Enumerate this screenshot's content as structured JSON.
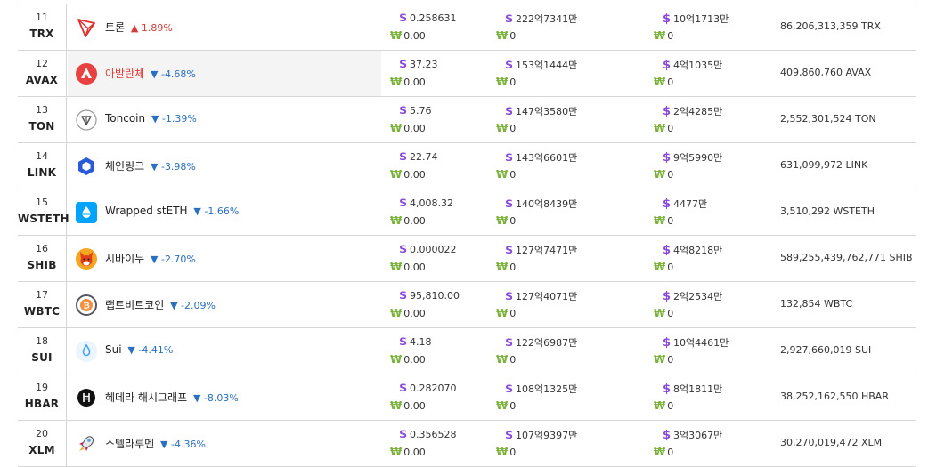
{
  "rows": [
    {
      "rank": "11",
      "symbol": "TRX",
      "name": "트론",
      "name_red": false,
      "arrow": "▲",
      "dir": "up",
      "change": "1.89%",
      "price_usd": "0.258631",
      "price_krw": "0.00",
      "cap_usd": "222억7341만",
      "cap_krw": "0",
      "vol_usd": "10억1713만",
      "vol_krw": "0",
      "supply": "86,206,313,359 TRX",
      "icon": "tron-icon",
      "highlight": false
    },
    {
      "rank": "12",
      "symbol": "AVAX",
      "name": "아발란체",
      "name_red": true,
      "arrow": "▼",
      "dir": "down",
      "change": "-4.68%",
      "price_usd": "37.23",
      "price_krw": "0.00",
      "cap_usd": "153억1444만",
      "cap_krw": "0",
      "vol_usd": "4억1035만",
      "vol_krw": "0",
      "supply": "409,860,760 AVAX",
      "icon": "avalanche-icon",
      "highlight": true
    },
    {
      "rank": "13",
      "symbol": "TON",
      "name": "Toncoin",
      "name_red": false,
      "arrow": "▼",
      "dir": "down",
      "change": "-1.39%",
      "price_usd": "5.76",
      "price_krw": "0.00",
      "cap_usd": "147억3580만",
      "cap_krw": "0",
      "vol_usd": "2억4285만",
      "vol_krw": "0",
      "supply": "2,552,301,524 TON",
      "icon": "toncoin-icon",
      "highlight": false
    },
    {
      "rank": "14",
      "symbol": "LINK",
      "name": "체인링크",
      "name_red": false,
      "arrow": "▼",
      "dir": "down",
      "change": "-3.98%",
      "price_usd": "22.74",
      "price_krw": "0.00",
      "cap_usd": "143억6601만",
      "cap_krw": "0",
      "vol_usd": "9억5990만",
      "vol_krw": "0",
      "supply": "631,099,972 LINK",
      "icon": "chainlink-icon",
      "highlight": false
    },
    {
      "rank": "15",
      "symbol": "WSTETH",
      "name": "Wrapped stETH",
      "name_red": false,
      "arrow": "▼",
      "dir": "down",
      "change": "-1.66%",
      "price_usd": "4,008.32",
      "price_krw": "0.00",
      "cap_usd": "140억8439만",
      "cap_krw": "0",
      "vol_usd": "4477만",
      "vol_krw": "0",
      "supply": "3,510,292 WSTETH",
      "icon": "wsteth-icon",
      "highlight": false
    },
    {
      "rank": "16",
      "symbol": "SHIB",
      "name": "시바이누",
      "name_red": false,
      "arrow": "▼",
      "dir": "down",
      "change": "-2.70%",
      "price_usd": "0.000022",
      "price_krw": "0.00",
      "cap_usd": "127억7471만",
      "cap_krw": "0",
      "vol_usd": "4억8218만",
      "vol_krw": "0",
      "supply": "589,255,439,762,771 SHIB",
      "icon": "shiba-inu-icon",
      "highlight": false
    },
    {
      "rank": "17",
      "symbol": "WBTC",
      "name": "랩트비트코인",
      "name_red": false,
      "arrow": "▼",
      "dir": "down",
      "change": "-2.09%",
      "price_usd": "95,810.00",
      "price_krw": "0.00",
      "cap_usd": "127억4071만",
      "cap_krw": "0",
      "vol_usd": "2억2534만",
      "vol_krw": "0",
      "supply": "132,854 WBTC",
      "icon": "wbtc-icon",
      "highlight": false
    },
    {
      "rank": "18",
      "symbol": "SUI",
      "name": "Sui",
      "name_red": false,
      "arrow": "▼",
      "dir": "down",
      "change": "-4.41%",
      "price_usd": "4.18",
      "price_krw": "0.00",
      "cap_usd": "122억6987만",
      "cap_krw": "0",
      "vol_usd": "10억4461만",
      "vol_krw": "0",
      "supply": "2,927,660,019 SUI",
      "icon": "sui-icon",
      "highlight": false
    },
    {
      "rank": "19",
      "symbol": "HBAR",
      "name": "헤데라 해시그래프",
      "name_red": false,
      "arrow": "▼",
      "dir": "down",
      "change": "-8.03%",
      "price_usd": "0.282070",
      "price_krw": "0.00",
      "cap_usd": "108억1325만",
      "cap_krw": "0",
      "vol_usd": "8억1811만",
      "vol_krw": "0",
      "supply": "38,252,162,550 HBAR",
      "icon": "hedera-icon",
      "highlight": false
    },
    {
      "rank": "20",
      "symbol": "XLM",
      "name": "스텔라루멘",
      "name_red": false,
      "arrow": "▼",
      "dir": "down",
      "change": "-4.36%",
      "price_usd": "0.356528",
      "price_krw": "0.00",
      "cap_usd": "107억9397만",
      "cap_krw": "0",
      "vol_usd": "3억3067만",
      "vol_krw": "0",
      "supply": "30,270,019,472 XLM",
      "icon": "stellar-icon",
      "highlight": false
    }
  ],
  "currency": {
    "usd_symbol": "$",
    "krw_symbol": "₩"
  },
  "colors": {
    "usd": "#8a4bd9",
    "krw": "#7ab23a",
    "up": "#d63a3a",
    "down": "#2a6fc0",
    "accent_name": "#e03d36"
  }
}
